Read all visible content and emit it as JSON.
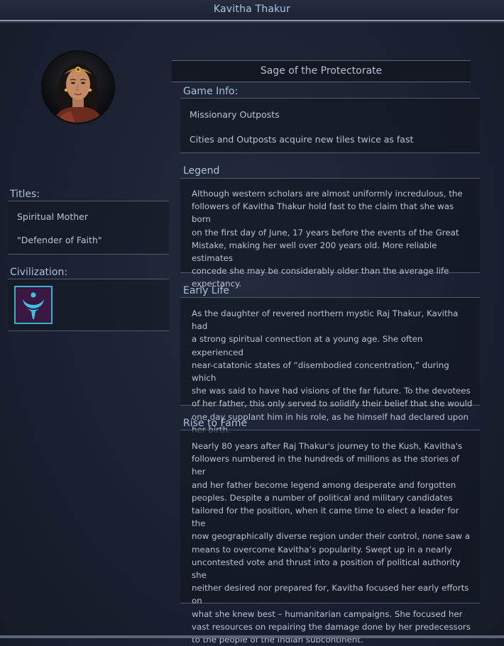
{
  "window": {
    "title": "Kavitha Thakur"
  },
  "portrait": {
    "icon": "leader-portrait"
  },
  "leader_title": "Sage of the Protectorate",
  "titles": {
    "heading": "Titles:",
    "items": [
      "Spiritual Mother",
      "\"Defender of Faith\""
    ]
  },
  "civilization": {
    "heading": "Civilization:",
    "icon": "protectorate-emblem-icon",
    "icon_colors": {
      "border": "#2fb6c8",
      "background": "#3a1740",
      "emblem": "#3cc2e0"
    }
  },
  "game_info": {
    "heading": "Game Info:",
    "items": [
      "Missionary Outposts",
      "Cities and Outposts acquire new tiles twice as fast"
    ]
  },
  "legend": {
    "heading": "Legend",
    "lines": [
      "Although western scholars are almost uniformly incredulous, the",
      "followers of Kavitha Thakur hold fast to the claim that she was born",
      "on the first day of June, 17 years before the events of the Great",
      "Mistake, making her well over 200 years old. More reliable estimates",
      "concede she may be considerably older than the average life",
      "expectancy."
    ]
  },
  "early_life": {
    "heading": "Early Life",
    "lines": [
      "As the daughter of revered northern mystic Raj Thakur, Kavitha had",
      "a strong spiritual connection at a young age. She often experienced",
      "near-catatonic states of “disembodied concentration,” during which",
      "she was said to have had visions of the far future. To the devotees",
      "of her father, this only served to solidify their belief that she would",
      "one day supplant him in his role, as he himself had declared upon",
      "her birth."
    ]
  },
  "rise_to_fame": {
    "heading": "Rise to Fame",
    "lines": [
      "Nearly 80 years after Raj Thakur's journey to the Kush, Kavitha's",
      "followers numbered in the hundreds of millions as the stories of her",
      "and her father become legend among desperate and forgotten",
      "peoples.  Despite a number of political and military candidates",
      "tailored for the position, when it came time to elect a leader for the",
      "now geographically diverse region under their control, none saw a",
      "means to overcome Kavitha’s popularity.  Swept up in a nearly",
      "uncontested vote and thrust into a position of political authority she",
      "neither desired nor prepared for, Kavitha focused her early efforts on",
      "what she knew best – humanitarian campaigns. She focused her",
      "vast resources on repairing the damage done by her predecessors",
      "to the people of the Indian subcontinent."
    ]
  }
}
